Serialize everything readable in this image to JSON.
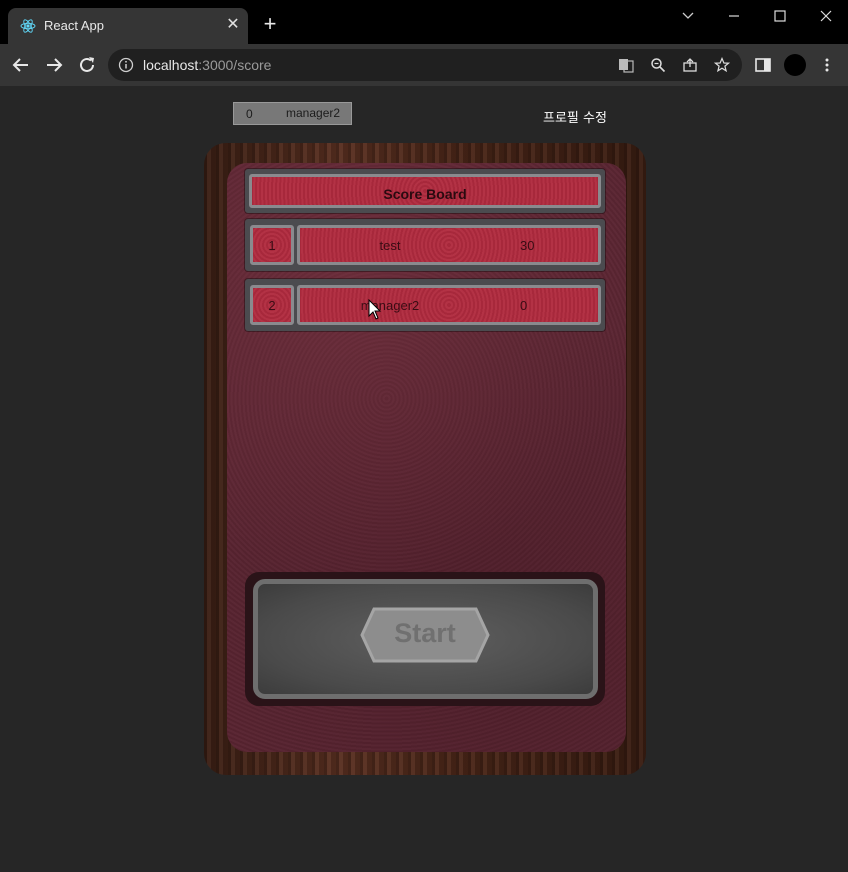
{
  "browser": {
    "tab_title": "React App",
    "url_host": "localhost",
    "url_rest": ":3000/score"
  },
  "header": {
    "user_score": "0",
    "user_name": "manager2",
    "profile_edit": "프로필 수정"
  },
  "scoreboard": {
    "title": "Score Board",
    "rows": [
      {
        "rank": "1",
        "name": "test",
        "score": "30"
      },
      {
        "rank": "2",
        "name": "manager2",
        "score": "0"
      }
    ]
  },
  "start_label": "Start",
  "colors": {
    "felt": "#5a2532",
    "cell_red": "#b12b3f",
    "frame_wood": "#4a2618",
    "page_bg": "#262626"
  }
}
